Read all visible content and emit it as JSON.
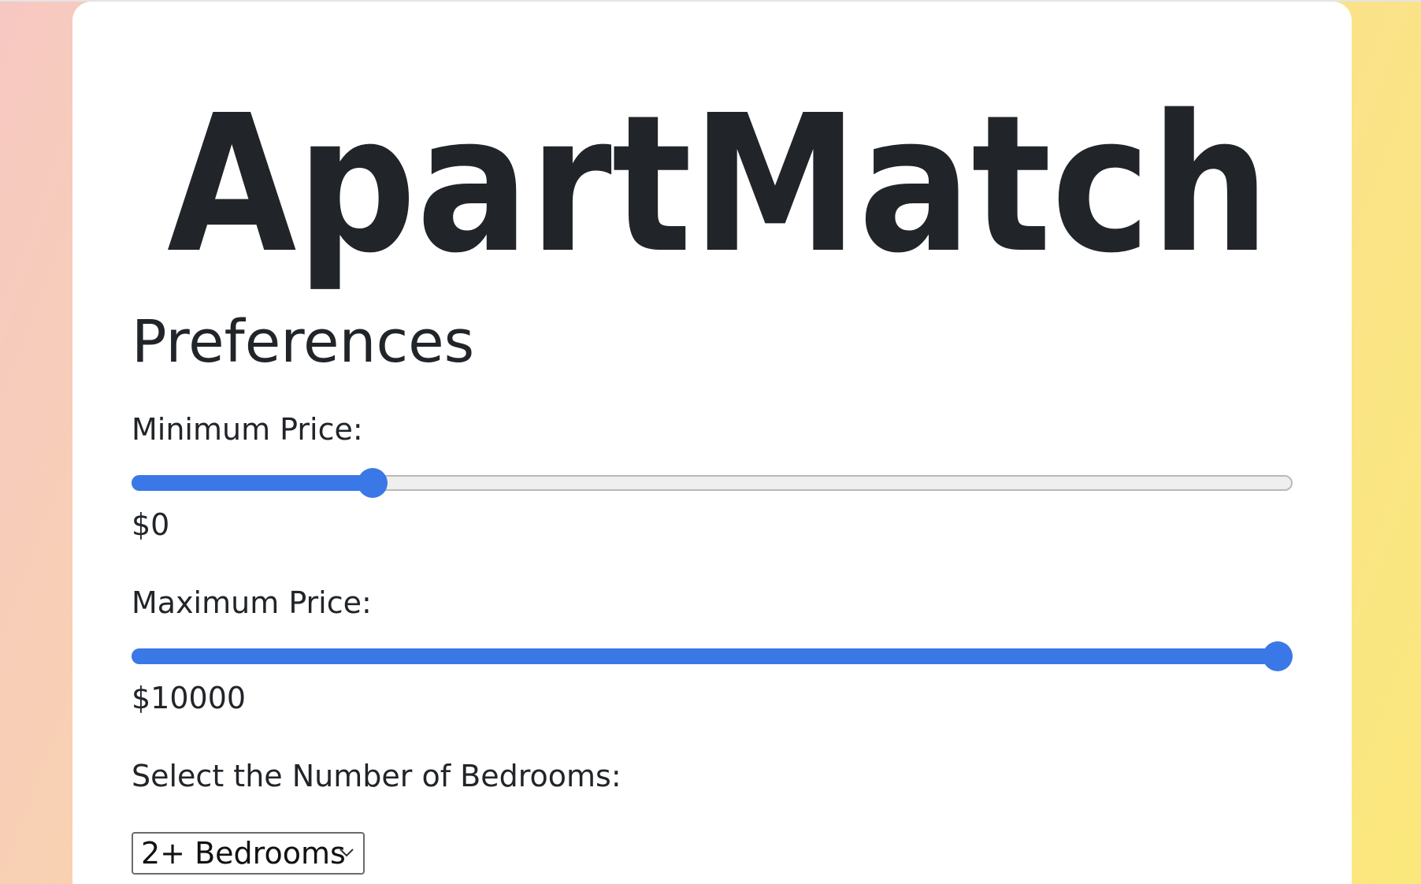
{
  "brand": {
    "logo_text": "ApartMatch"
  },
  "preferences": {
    "title": "Preferences",
    "min_price": {
      "label": "Minimum Price:",
      "value_text": "$0",
      "slider_fraction": 0.2
    },
    "max_price": {
      "label": "Maximum Price:",
      "value_text": "$10000",
      "slider_fraction": 1.0
    },
    "bedrooms": {
      "label": "Select the Number of Bedrooms:",
      "selected": "2+ Bedrooms"
    }
  },
  "colors": {
    "accent": "#3b78e7",
    "text": "#212529",
    "card": "#ffffff"
  },
  "icons": {
    "select_arrow": "chevron-down-icon"
  }
}
